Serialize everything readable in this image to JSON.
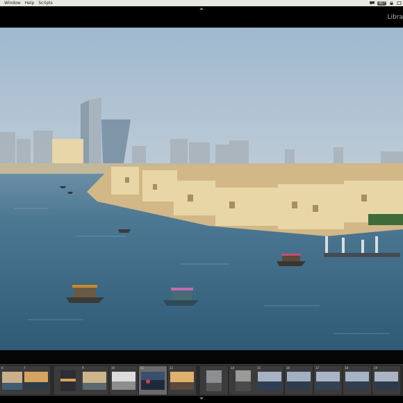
{
  "menubar": {
    "items": [
      "Window",
      "Help",
      "Scripts"
    ],
    "status": {
      "temperature": "41°"
    }
  },
  "header": {
    "module_label": "Libra"
  },
  "filmstrip": {
    "numbers": [
      "6",
      "7",
      "",
      "9",
      "10",
      "11",
      "12",
      "",
      "14",
      "15",
      "16",
      "17",
      "18",
      "19"
    ],
    "selected_index": 5
  },
  "colors": {
    "background": "#000000",
    "filmstrip": "#2a2a2a",
    "menubar": "#e9e7e2",
    "water": "#3d6b85",
    "sky": "#b8c9d8"
  }
}
